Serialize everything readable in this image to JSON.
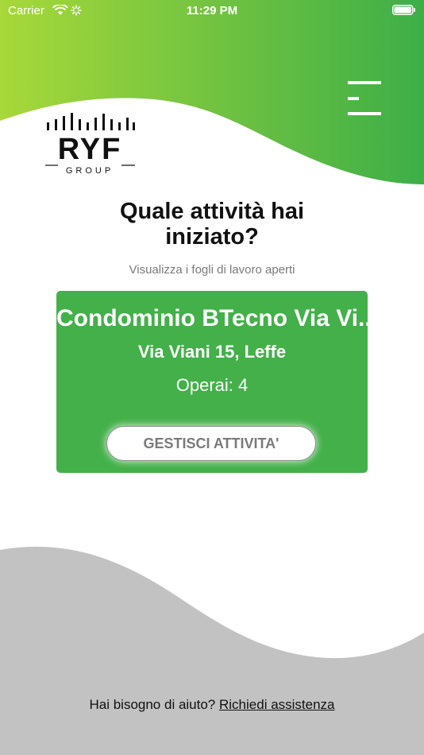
{
  "status_bar": {
    "carrier": "Carrier",
    "time": "11:29 PM"
  },
  "icons": {
    "menu": "hamburger-menu-icon",
    "wifi": "wifi-icon",
    "activity": "activity-spinner-icon",
    "battery": "battery-icon"
  },
  "logo": {
    "brand": "RYF",
    "sub": "GROUP"
  },
  "main": {
    "title_line1": "Quale attività hai",
    "title_line2": "iniziato?",
    "subtitle": "Visualizza i fogli di lavoro aperti"
  },
  "card": {
    "title": "Condominio BTecno Via Vi...",
    "address": "Via Viani 15, Leffe",
    "workers": "Operai: 4",
    "button_label": "GESTISCI ATTIVITA'"
  },
  "footer": {
    "help_text": "Hai bisogno di aiuto?",
    "help_link": "Richiedi assistenza"
  },
  "colors": {
    "accent_green": "#44b04a",
    "gradient_light": "#a8d83a",
    "gradient_dark": "#3dae48",
    "footer_gray": "#c2c2c2"
  }
}
